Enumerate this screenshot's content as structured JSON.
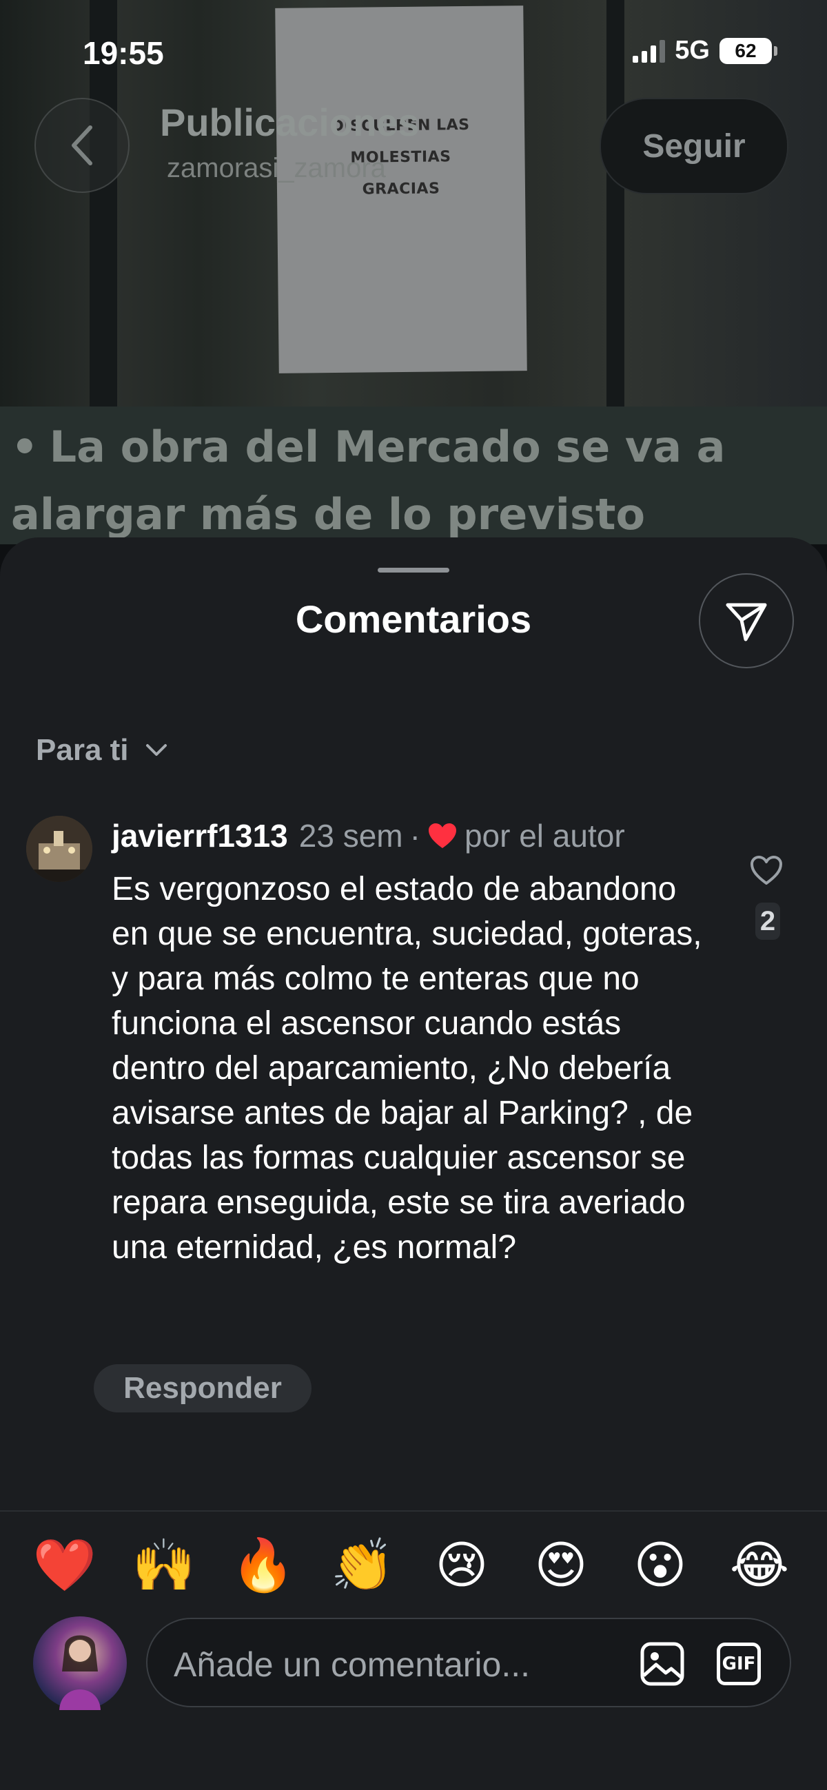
{
  "status": {
    "time": "19:55",
    "network": "5G",
    "battery": "62"
  },
  "post_header": {
    "title": "Publicaciones",
    "username": "zamorasi_zamora",
    "follow_label": "Seguir"
  },
  "background_post": {
    "notice_lines": [
      "DISCULPEN LAS",
      "MOLESTIAS",
      "GRACIAS"
    ],
    "banner_bullet": "•",
    "banner_text": "La obra del Mercado se va a alargar más de lo previsto"
  },
  "comments": {
    "title": "Comentarios",
    "sort_label": "Para ti",
    "items": [
      {
        "username": "javierrf1313",
        "time": "23 sem",
        "separator": "·",
        "liked_by_author_label": "por el autor",
        "text": "Es vergonzoso el estado de abandono en que se encuentra, suciedad, goteras, y para más colmo te enteras que no funciona el ascensor cuando estás dentro del  aparcamiento, ¿No debería avisarse antes de bajar al Parking? , de todas las formas cualquier ascensor se repara enseguida, este se tira averiado una eternidad, ¿es normal?",
        "like_count": "2",
        "reply_label": "Responder"
      }
    ]
  },
  "reactions": [
    "❤️",
    "🙌",
    "🔥",
    "👏",
    "😢",
    "😍",
    "😮",
    "😂"
  ],
  "composer": {
    "placeholder": "Añade un comentario...",
    "gif_label": "GIF"
  },
  "colors": {
    "sheet_bg": "#1b1d20",
    "heart_red": "#ff3040",
    "muted_text": "#9aa0a6"
  }
}
